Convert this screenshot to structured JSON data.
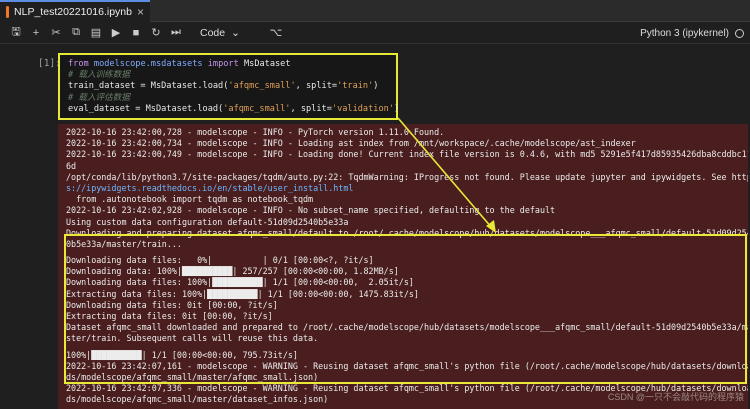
{
  "tab": {
    "title": "NLP_test20221016.ipynb",
    "close": "×"
  },
  "toolbar": {
    "icons": [
      "save-icon",
      "add-cell-icon",
      "cut-icon",
      "copy-icon",
      "paste-icon",
      "run-icon",
      "stop-icon",
      "restart-icon",
      "restart-run-icon"
    ],
    "cell_type": "Code",
    "kernel": "Python 3 (ipykernel)"
  },
  "cell": {
    "prompt": "[1]:",
    "code": {
      "l1_kw": "from",
      "l1_mod": "modelscope.msdatasets",
      "l1_kw2": "import",
      "l1_name": "MsDataset",
      "l2": "# 载入训练数据",
      "l3_a": "train_dataset = MsDataset.load(",
      "l3_s1": "'afqmc_small'",
      "l3_b": ", split=",
      "l3_s2": "'train'",
      "l3_c": ")",
      "l4": "# 载入评估数据",
      "l5_a": "eval_dataset = MsDataset.load(",
      "l5_s1": "'afqmc_small'",
      "l5_b": ", split=",
      "l5_s2": "'validation'",
      "l5_c": ")"
    }
  },
  "output": {
    "lines": [
      "2022-10-16 23:42:00,728 - modelscope - INFO - PyTorch version 1.11.0 Found.",
      "2022-10-16 23:42:00,734 - modelscope - INFO - Loading ast index from /mnt/workspace/.cache/modelscope/ast_indexer",
      "2022-10-16 23:42:00,749 - modelscope - INFO - Loading done! Current index file version is 0.4.6, with md5 5291e5f417d85935426dba8cddbc11",
      "6d",
      "/opt/conda/lib/python3.7/site-packages/tqdm/auto.py:22: TqdmWarning: IProgress not found. Please update jupyter and ipywidgets. See http",
      "s://ipywidgets.readthedocs.io/en/stable/user_install.html",
      "  from .autonotebook import tqdm as notebook_tqdm",
      "2022-10-16 23:42:02,928 - modelscope - INFO - No subset_name specified, defaulting to the default",
      "Using custom data configuration default-51d09d2540b5e33a",
      "Downloading and preparing dataset afqmc_small/default to /root/.cache/modelscope/hub/datasets/modelscope___afqmc_small/default-51d09d254",
      "0b5e33a/master/train...",
      "",
      "Downloading data files:   0%|          | 0/1 [00:00<?, ?it/s]",
      "Downloading data: 100%|██████████| 257/257 [00:00<00:00, 1.82MB/s]",
      "Downloading data files: 100%|██████████| 1/1 [00:00<00:00,  2.05it/s]",
      "Extracting data files: 100%|██████████| 1/1 [00:00<00:00, 1475.83it/s]",
      "Downloading data files: 0it [00:00, ?it/s]",
      "Extracting data files: 0it [00:00, ?it/s]",
      "Dataset afqmc_small downloaded and prepared to /root/.cache/modelscope/hub/datasets/modelscope___afqmc_small/default-51d09d2540b5e33a/ma",
      "ster/train. Subsequent calls will reuse this data.",
      "",
      "100%|██████████| 1/1 [00:00<00:00, 795.73it/s]",
      "2022-10-16 23:42:07,161 - modelscope - WARNING - Reusing dataset afqmc_small's python file (/root/.cache/modelscope/hub/datasets/downloa",
      "ds/modelscope/afqmc_small/master/afqmc_small.json)",
      "2022-10-16 23:42:07,336 - modelscope - WARNING - Reusing dataset afqmc_small's python file (/root/.cache/modelscope/hub/datasets/downloa",
      "ds/modelscope/afqmc_small/master/dataset_infos.json)"
    ]
  },
  "watermark": "CSDN @一只不会敲代码的程序猿"
}
